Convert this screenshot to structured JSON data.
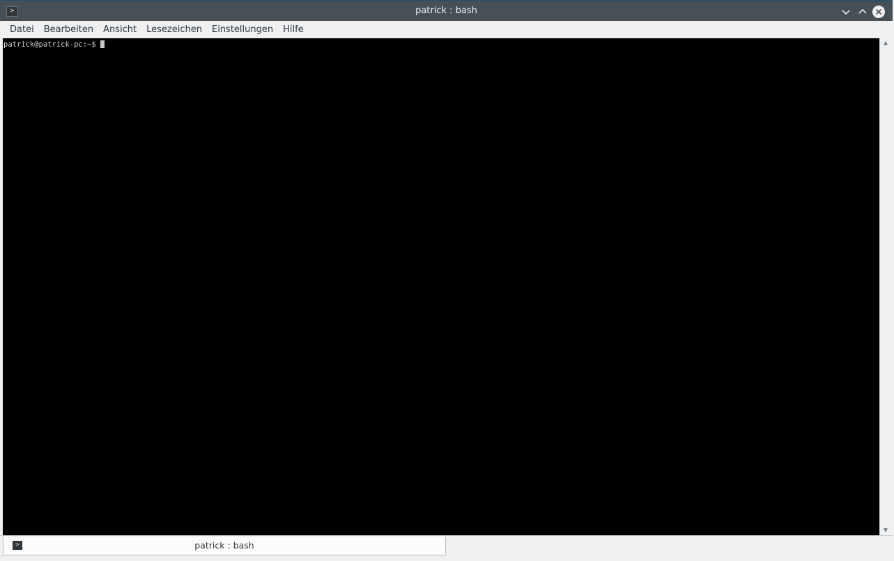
{
  "window": {
    "title": "patrick : bash",
    "icons": {
      "app": "terminal-icon",
      "minimize": "chevron-down-icon",
      "maximize": "chevron-up-icon",
      "close": "close-icon"
    }
  },
  "menubar": {
    "items": [
      {
        "label": "Datei"
      },
      {
        "label": "Bearbeiten"
      },
      {
        "label": "Ansicht"
      },
      {
        "label": "Lesezeichen"
      },
      {
        "label": "Einstellungen"
      },
      {
        "label": "Hilfe"
      }
    ]
  },
  "terminal": {
    "prompt": "patrick@patrick-pc:~$"
  },
  "tabs": [
    {
      "label": "patrick : bash",
      "icon": "terminal-icon"
    }
  ],
  "colors": {
    "titlebar": "#475057",
    "terminal_bg": "#000000",
    "terminal_fg": "#d6d6d6",
    "chrome": "#eff0f1"
  }
}
